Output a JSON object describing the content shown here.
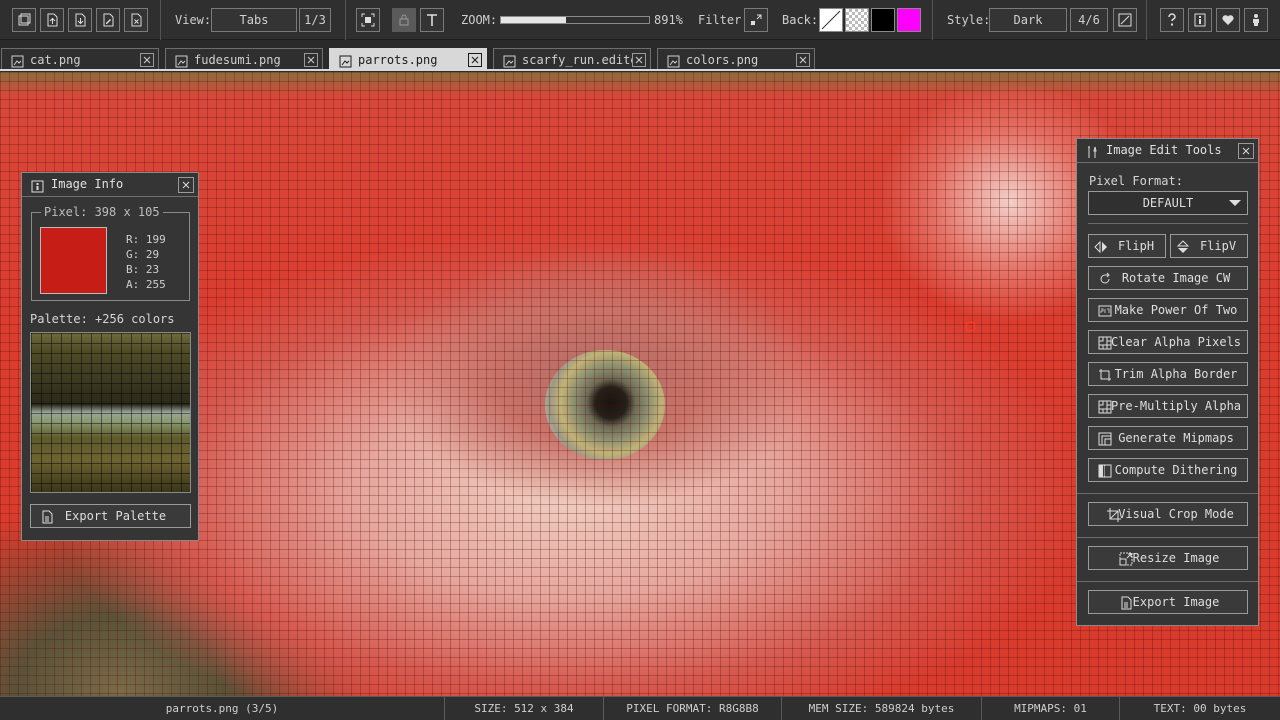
{
  "toolbar": {
    "view_label": "View:",
    "view_value": "Tabs",
    "view_count": "1/3",
    "zoom_label": "ZOOM:",
    "zoom_value": "891%",
    "zoom_fraction": 0.44,
    "filter_label": "Filter:",
    "back_label": "Back:",
    "back_colors": [
      "#ffffff",
      "checker",
      "#000000",
      "#ff00ff"
    ],
    "style_label": "Style:",
    "style_value": "Dark",
    "style_count": "4/6",
    "file_icons": [
      "new-file-icon",
      "open-file-icon",
      "save-file-icon",
      "edit-file-icon",
      "close-file-icon"
    ],
    "right_icons": [
      "help-icon",
      "info-icon",
      "heart-icon",
      "person-icon"
    ]
  },
  "tabs": [
    {
      "label": "cat.png",
      "active": false
    },
    {
      "label": "fudesumi.png",
      "active": false
    },
    {
      "label": "parrots.png",
      "active": true
    },
    {
      "label": "scarfy_run.edited",
      "active": false
    },
    {
      "label": "colors.png",
      "active": false
    }
  ],
  "image_info": {
    "title": "Image Info",
    "pixel_label": "Pixel: 398 x 105",
    "pixel_color": "#c71d17",
    "r": "R: 199",
    "g": "G: 29",
    "b": "B: 23",
    "a": "A: 255",
    "palette_label": "Palette: +256 colors",
    "export_palette": "Export Palette"
  },
  "tools": {
    "title": "Image Edit Tools",
    "pixel_format_label": "Pixel Format:",
    "pixel_format_value": "DEFAULT",
    "fliph": "FlipH",
    "flipv": "FlipV",
    "rotate": "Rotate Image CW",
    "power_two": "Make Power Of Two",
    "clear_alpha": "Clear Alpha Pixels",
    "trim_alpha": "Trim Alpha Border",
    "premultiply": "Pre-Multiply Alpha",
    "mipmaps": "Generate Mipmaps",
    "dithering": "Compute Dithering",
    "crop": "Visual Crop Mode",
    "resize": "Resize Image",
    "export": "Export Image"
  },
  "status": {
    "file": "parrots.png (3/5)",
    "size": "SIZE:  512 x 384",
    "format": "PIXEL FORMAT: R8G8B8",
    "mem": "MEM SIZE: 589824 bytes",
    "mipmaps": "MIPMAPS: 01",
    "text": "TEXT: 00 bytes"
  },
  "colors": {
    "accent": "#d8d8d8",
    "background": "#2f2f2f"
  }
}
